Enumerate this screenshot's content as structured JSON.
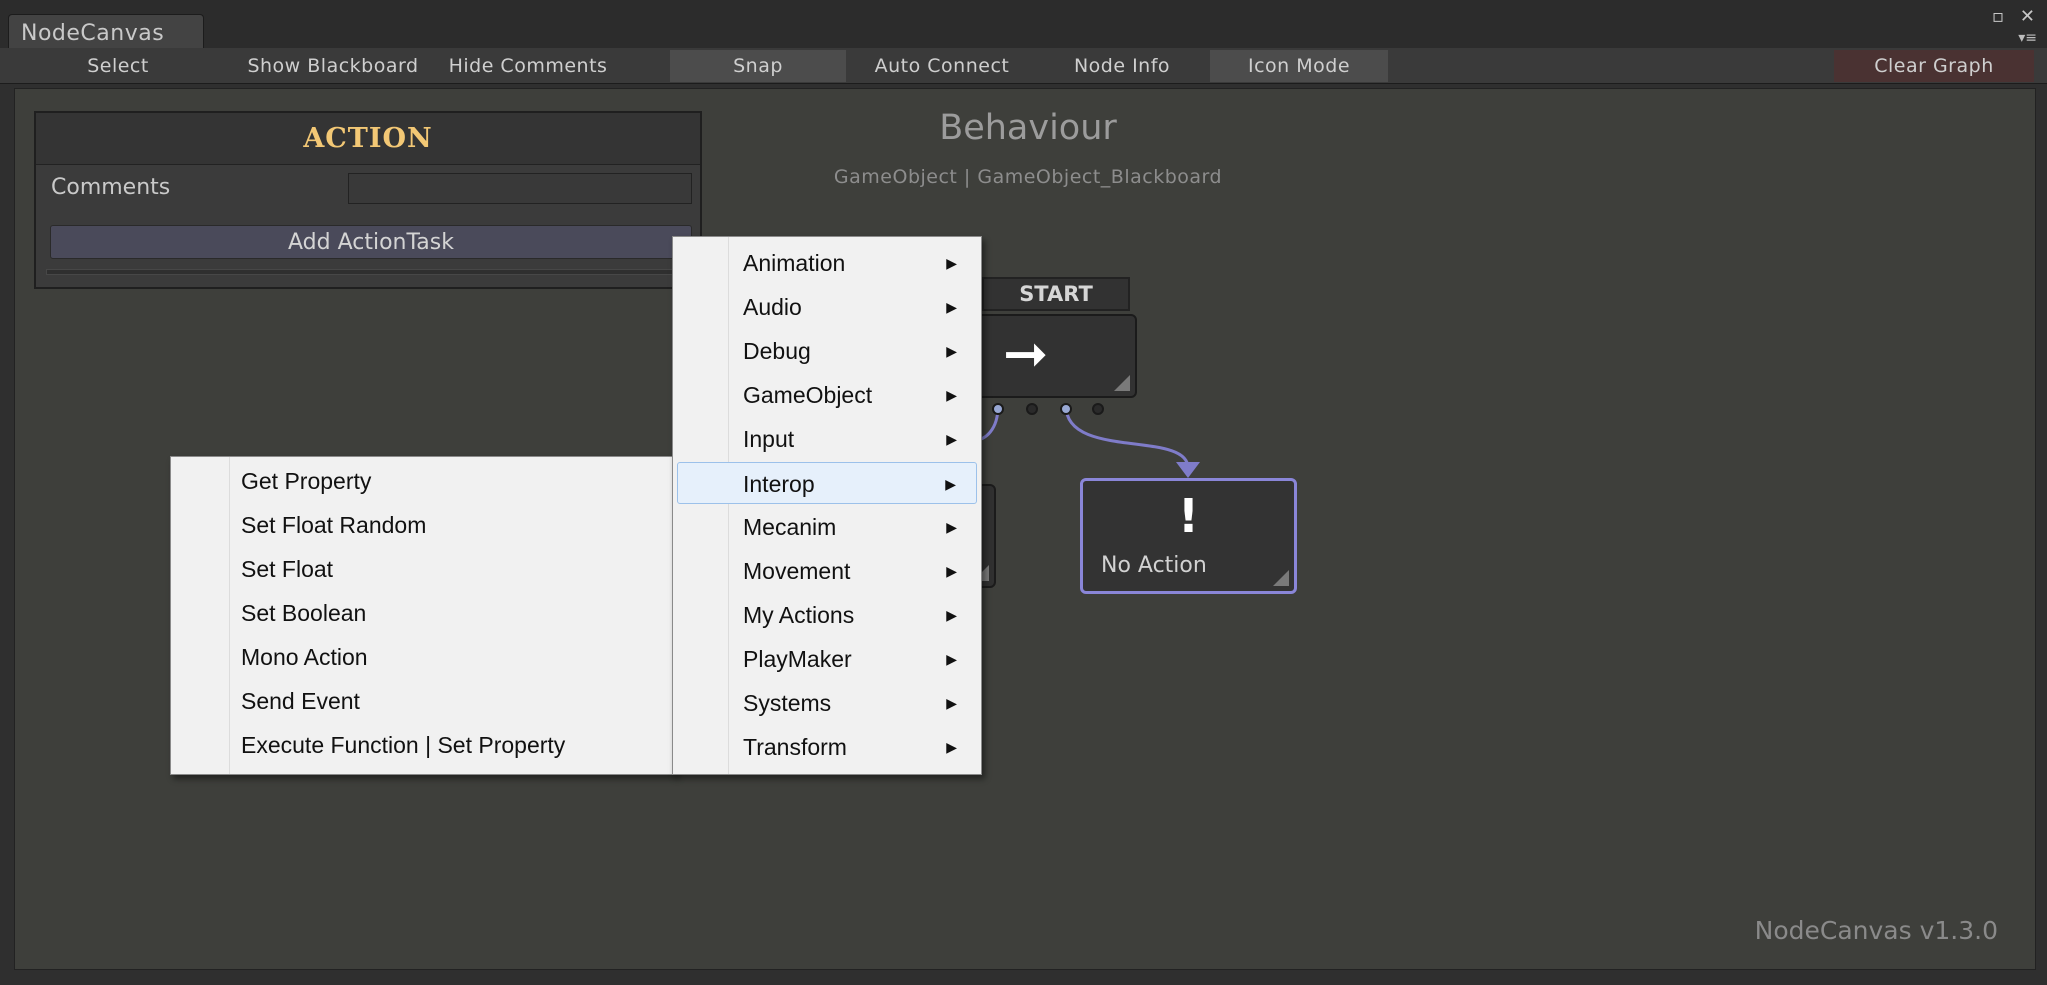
{
  "window": {
    "tab_title": "NodeCanvas",
    "icons": [
      "restore-icon",
      "close-icon",
      "menu-icon"
    ]
  },
  "toolbar": {
    "select": "Select",
    "show_blackboard": "Show Blackboard",
    "hide_comments": "Hide Comments",
    "snap": "Snap",
    "auto_connect": "Auto Connect",
    "node_info": "Node Info",
    "icon_mode": "Icon Mode",
    "clear_graph": "Clear Graph"
  },
  "inspector": {
    "title": "ACTION",
    "comments_label": "Comments",
    "comments_value": "",
    "add_button": "Add ActionTask"
  },
  "graph": {
    "title": "Behaviour",
    "subtitle": "GameObject | GameObject_Blackboard"
  },
  "nodes": {
    "start_label": "START",
    "start_icon": "arrow-right-icon",
    "no_action_icon": "!",
    "no_action_label": "No Action"
  },
  "menu_main": {
    "items": [
      "Animation",
      "Audio",
      "Debug",
      "GameObject",
      "Input",
      "Interop",
      "Mecanim",
      "Movement",
      "My Actions",
      "PlayMaker",
      "Systems",
      "Transform"
    ],
    "highlighted": "Interop"
  },
  "menu_sub": {
    "items": [
      "Get Property",
      "Set Float Random",
      "Set Float",
      "Set Boolean",
      "Mono Action",
      "Send Event",
      "Execute Function | Set Property"
    ]
  },
  "footer": {
    "version": "NodeCanvas v1.3.0"
  },
  "colors": {
    "accent_title": "#f3c875",
    "selected_node_border": "#8a86d8",
    "connection": "#7f7cc9",
    "menu_highlight": "#e6f0fb"
  }
}
